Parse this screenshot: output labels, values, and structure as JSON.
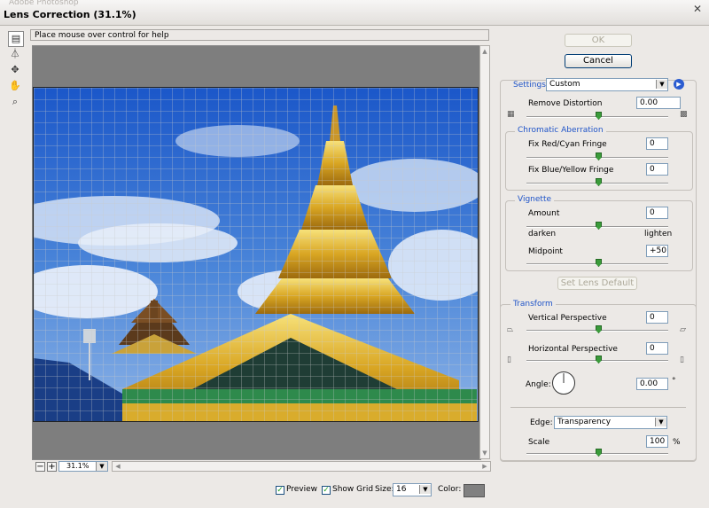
{
  "window": {
    "ghost_title": "Adobe Photoshop",
    "title": "Lens Correction (31.1%)",
    "close_glyph": "✕"
  },
  "tools": [
    {
      "name": "remove-distortion-tool",
      "icon": "grid-icon",
      "glyph": "▤"
    },
    {
      "name": "straighten-tool",
      "icon": "straighten-icon",
      "glyph": "⏃"
    },
    {
      "name": "move-grid-tool",
      "icon": "move-grid-icon",
      "glyph": "✥"
    },
    {
      "name": "hand-tool",
      "icon": "hand-icon",
      "glyph": "✋"
    },
    {
      "name": "zoom-tool",
      "icon": "magnifier-icon",
      "glyph": "⌕"
    }
  ],
  "hint": "Place mouse over control for help",
  "buttons": {
    "ok": "OK",
    "cancel": "Cancel",
    "set_lens_default": "Set Lens Default"
  },
  "settings": {
    "label": "Settings:",
    "value": "Custom"
  },
  "remove_distortion": {
    "label": "Remove Distortion",
    "value": "0.00",
    "level": 0.5
  },
  "chromatic": {
    "title": "Chromatic Aberration",
    "red_cyan": {
      "label": "Fix Red/Cyan Fringe",
      "value": "0",
      "level": 0.5
    },
    "blue_yellow": {
      "label": "Fix Blue/Yellow Fringe",
      "value": "0",
      "level": 0.5
    }
  },
  "vignette": {
    "title": "Vignette",
    "amount": {
      "label": "Amount",
      "value": "0",
      "level": 0.5
    },
    "darken": "darken",
    "lighten": "lighten",
    "midpoint": {
      "label": "Midpoint",
      "value": "+50",
      "level": 0.5
    }
  },
  "transform": {
    "title": "Transform",
    "vertical": {
      "label": "Vertical Perspective",
      "value": "0",
      "level": 0.5
    },
    "horizontal": {
      "label": "Horizontal Perspective",
      "value": "0",
      "level": 0.5
    },
    "angle": {
      "label": "Angle:",
      "value": "0.00",
      "unit": "°"
    },
    "edge": {
      "label": "Edge:",
      "value": "Transparency"
    },
    "scale": {
      "label": "Scale",
      "value": "100",
      "unit": "%",
      "level": 0.5
    }
  },
  "zoom": {
    "minus": "−",
    "plus": "+",
    "value": "31.1%"
  },
  "options": {
    "preview": {
      "label": "Preview",
      "checked": true
    },
    "show_grid": {
      "label": "Show Grid",
      "checked": true
    },
    "size": {
      "label": "Size:",
      "value": "16"
    },
    "color": {
      "label": "Color:",
      "swatch": "#808080"
    }
  },
  "colors": {
    "accent": "#1f54c8",
    "thumb": "#3a9b3a"
  }
}
